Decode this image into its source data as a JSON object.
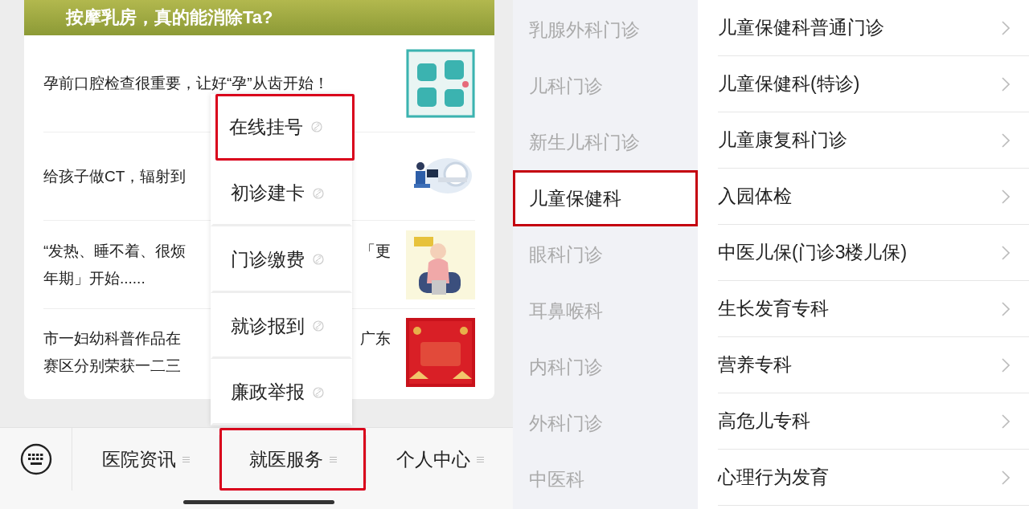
{
  "news_banner": {
    "title": "按摩乳房，真的能消除Ta?"
  },
  "articles": [
    {
      "lines": [
        {
          "left": "孕前口腔检查很重要，让好“孕”从齿开始！"
        }
      ]
    },
    {
      "lines": [
        {
          "left": "给孩子做CT，辐射到"
        }
      ]
    },
    {
      "lines": [
        {
          "left": "“发热、睡不着、很烦",
          "right": "「更"
        },
        {
          "left": "年期」开始......"
        }
      ]
    },
    {
      "lines": [
        {
          "left": "市一妇幼科普作品在",
          "right": "广东"
        },
        {
          "left": "赛区分别荣获一二三"
        }
      ]
    }
  ],
  "popup_menu": {
    "items": [
      {
        "label": "在线挂号",
        "highlighted": true
      },
      {
        "label": "初诊建卡",
        "highlighted": false
      },
      {
        "label": "门诊缴费",
        "highlighted": false
      },
      {
        "label": "就诊报到",
        "highlighted": false
      },
      {
        "label": "廉政举报",
        "highlighted": false
      }
    ]
  },
  "tab_bar": {
    "tabs": [
      {
        "label": "医院资讯",
        "highlighted": false
      },
      {
        "label": "就医服务",
        "highlighted": true
      },
      {
        "label": "个人中心",
        "highlighted": false
      }
    ]
  },
  "departments": {
    "items": [
      {
        "label": "乳腺外科门诊",
        "selected": false,
        "highlighted": false
      },
      {
        "label": "儿科门诊",
        "selected": false,
        "highlighted": false
      },
      {
        "label": "新生儿科门诊",
        "selected": false,
        "highlighted": false
      },
      {
        "label": "儿童保健科",
        "selected": true,
        "highlighted": true
      },
      {
        "label": "眼科门诊",
        "selected": false,
        "highlighted": false
      },
      {
        "label": "耳鼻喉科",
        "selected": false,
        "highlighted": false
      },
      {
        "label": "内科门诊",
        "selected": false,
        "highlighted": false
      },
      {
        "label": "外科门诊",
        "selected": false,
        "highlighted": false
      },
      {
        "label": "中医科",
        "selected": false,
        "highlighted": false
      }
    ]
  },
  "clinics": {
    "items": [
      "儿童保健科普通门诊",
      "儿童保健科(特诊)",
      "儿童康复科门诊",
      "入园体检",
      "中医儿保(门诊3楼儿保)",
      "生长发育专科",
      "营养专科",
      "高危儿专科",
      "心理行为发育"
    ]
  }
}
